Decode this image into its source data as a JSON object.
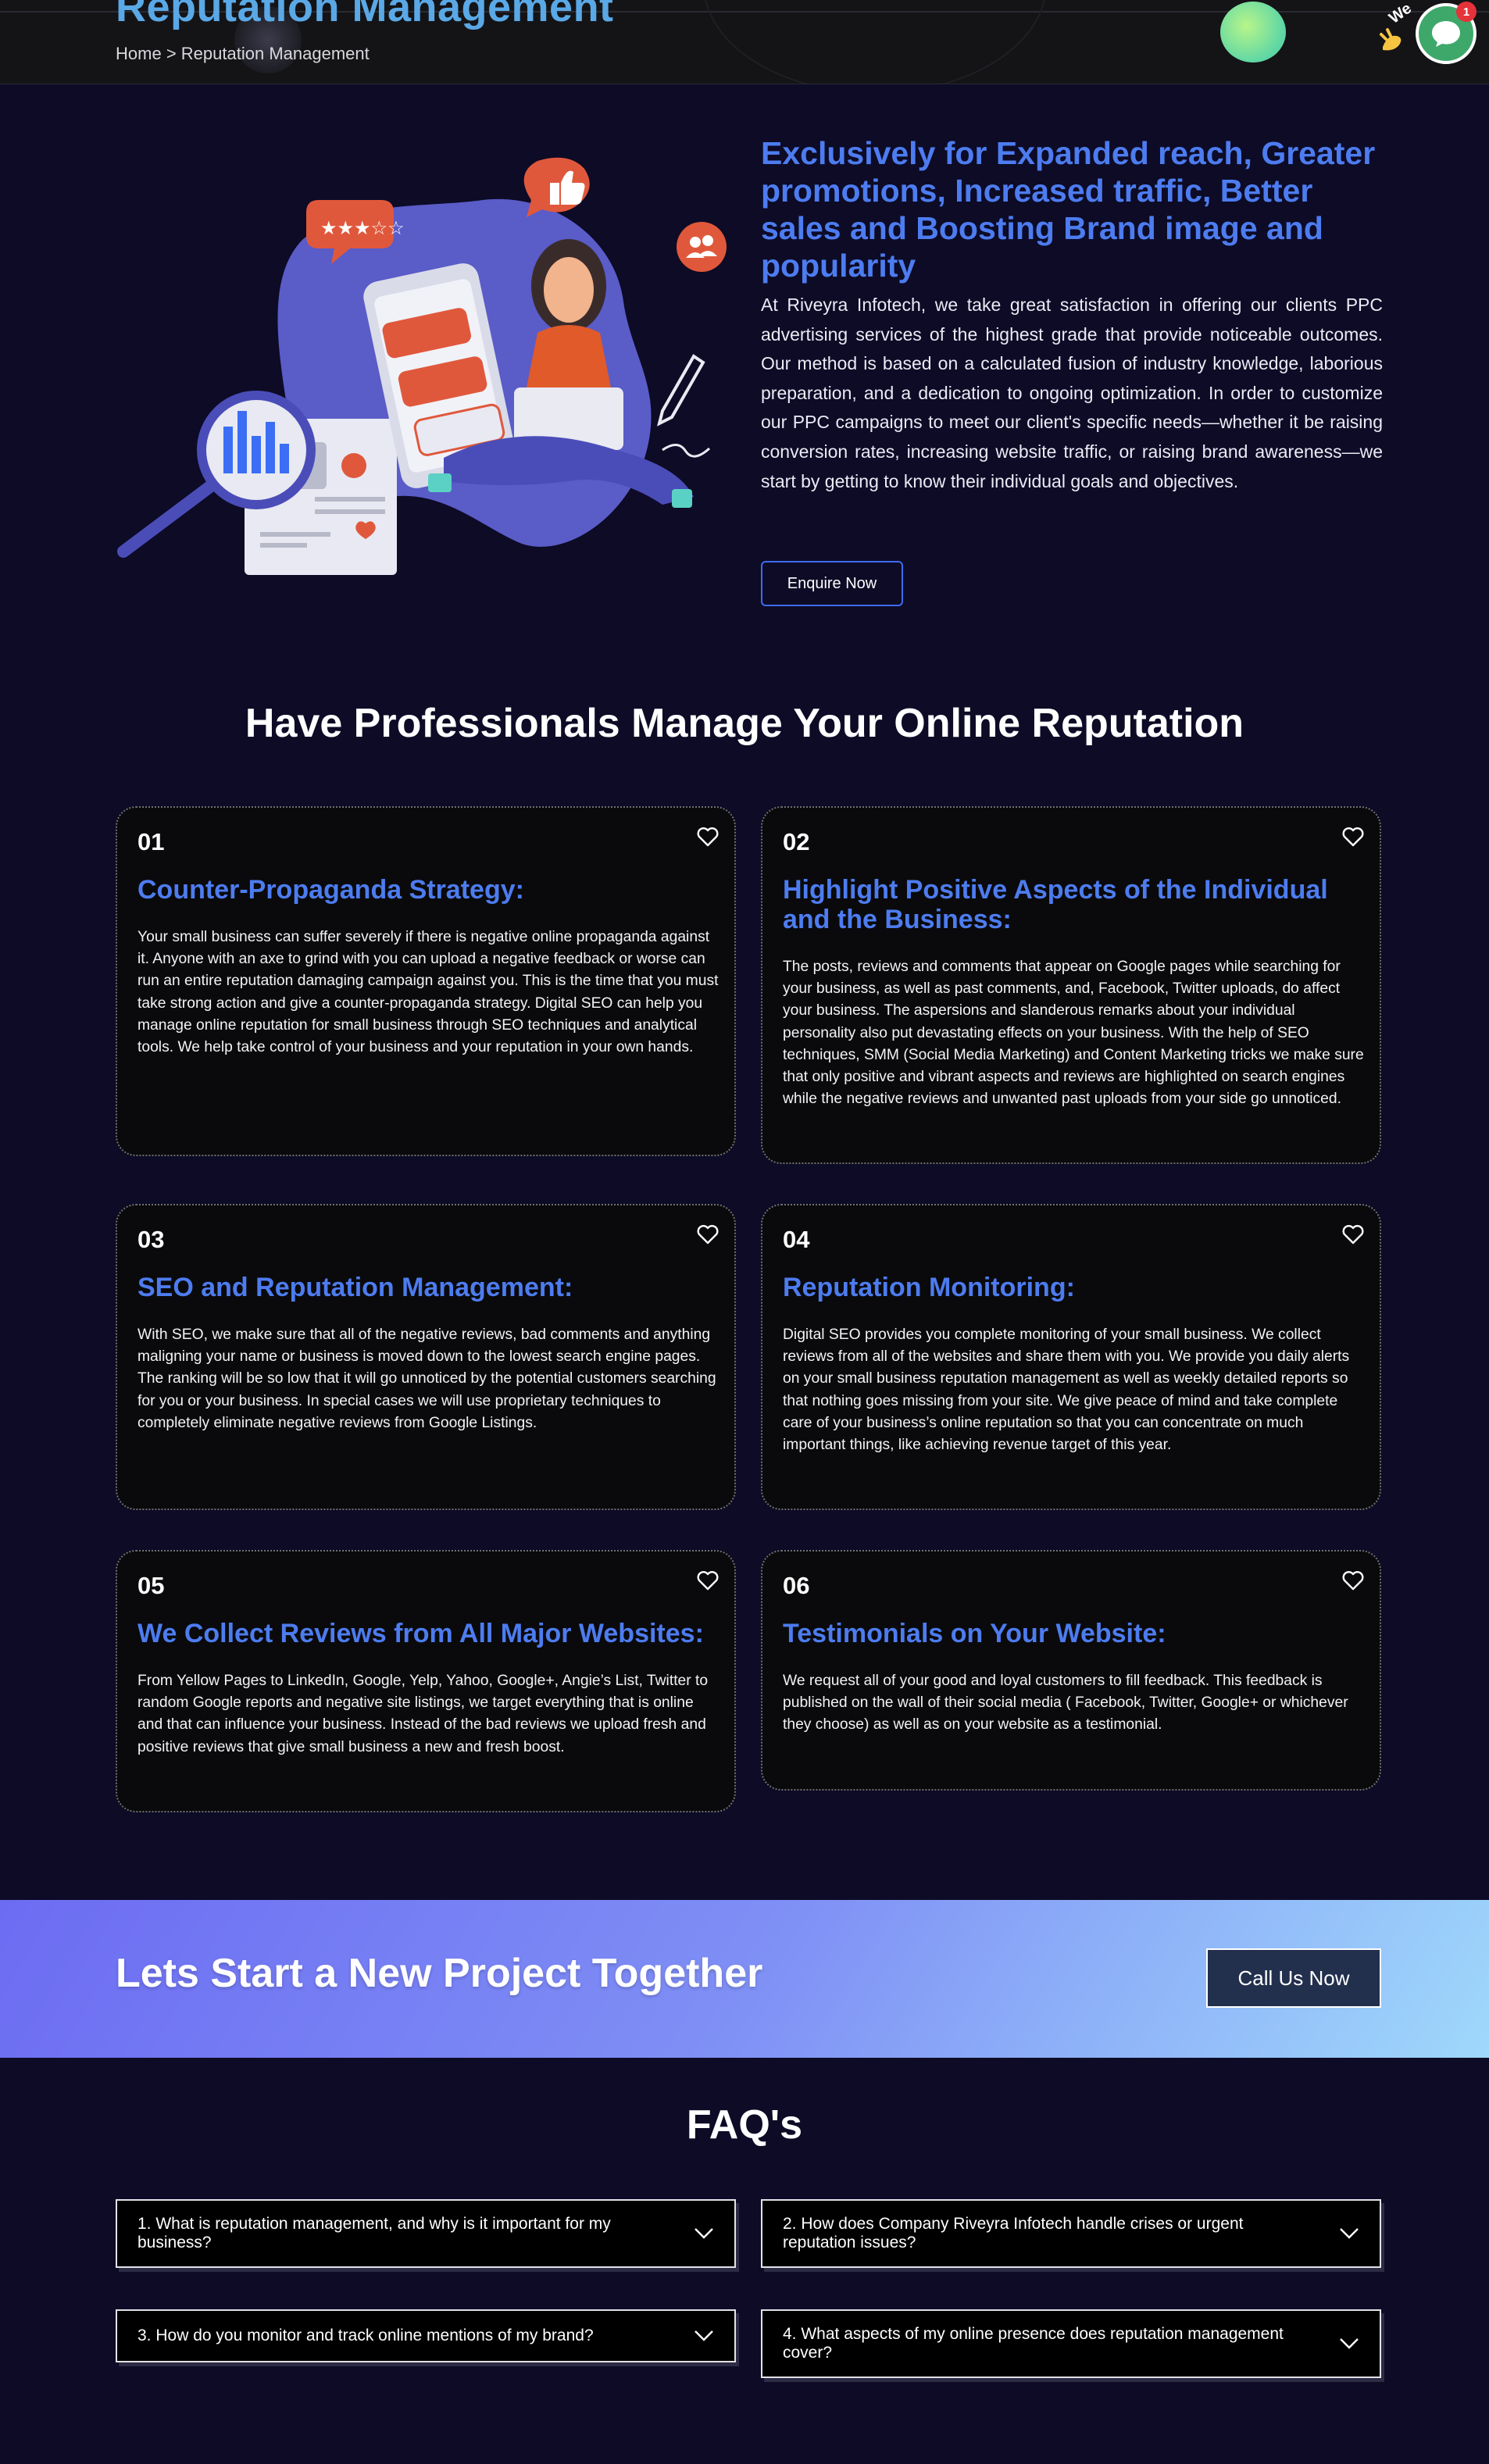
{
  "header": {
    "page_title": "Reputation Management",
    "breadcrumb": {
      "home": "Home",
      "separator": ">",
      "current": "Reputation Management"
    },
    "chat": {
      "badge_count": "1",
      "wave_text": "We"
    }
  },
  "intro": {
    "heading": "Exclusively for Expanded reach, Greater promotions, Increased traffic, Better sales and Boosting Brand image and popularity",
    "body": "At Riveyra Infotech, we take great satisfaction in offering our clients PPC advertising services of the highest grade that provide noticeable outcomes. Our method is based on a calculated fusion of industry knowledge, laborious preparation, and a dedication to ongoing optimization. In order to customize our PPC campaigns to meet our client's specific needs—whether it be raising conversion rates, increasing website traffic, or raising brand awareness—we start by getting to know their individual goals and objectives.",
    "button": "Enquire Now"
  },
  "services": {
    "title": "Have Professionals Manage Your Online Reputation",
    "cards": [
      {
        "num": "01",
        "title": "Counter-Propaganda Strategy:",
        "body": "Your small business can suffer severely if there is negative online propaganda against it. Anyone with an axe to grind with you can upload a negative feedback or worse can run an entire reputation damaging campaign against you. This is the time that you must take strong action and give a counter-propaganda strategy. Digital SEO can help you manage online reputation for small business through SEO techniques and analytical tools. We help take control of your business and your reputation in your own hands."
      },
      {
        "num": "02",
        "title": "Highlight Positive Aspects of the Individual and the Business:",
        "body": "The posts, reviews and comments that appear on Google pages while searching for your business, as well as past comments, and, Facebook, Twitter uploads, do affect your business. The aspersions and slanderous remarks about your individual personality also put devastating effects on your business. With the help of SEO techniques, SMM (Social Media Marketing) and Content Marketing tricks we make sure that only positive and vibrant aspects and reviews are highlighted on search engines while the negative reviews and unwanted past uploads from your side go unnoticed."
      },
      {
        "num": "03",
        "title": "SEO and Reputation Management:",
        "body": "With SEO, we make sure that all of the negative reviews, bad comments and anything maligning your name or business is moved down to the lowest search engine pages. The ranking will be so low that it will go unnoticed by the potential customers searching for you or your business. In special cases we will use proprietary techniques to completely eliminate negative reviews from Google Listings."
      },
      {
        "num": "04",
        "title": "Reputation Monitoring:",
        "body": "Digital SEO provides you complete monitoring of your small business. We collect reviews from all of the websites and share them with you. We provide you daily alerts on your small business reputation management as well as weekly detailed reports so that nothing goes missing from your site. We give peace of mind and take complete care of your business’s online reputation so that you can concentrate on much important things, like achieving revenue target of this year."
      },
      {
        "num": "05",
        "title": "We Collect Reviews from All Major Websites:",
        "body": "From Yellow Pages to LinkedIn, Google, Yelp, Yahoo, Google+, Angie’s List, Twitter to random Google reports and negative site listings, we target everything that is online and that can influence your business. Instead of the bad reviews we upload fresh and positive reviews that give small business a new and fresh boost."
      },
      {
        "num": "06",
        "title": "Testimonials on Your Website:",
        "body": "We request all of your good and loyal customers to fill feedback. This feedback is published on the wall of their social media ( Facebook, Twitter, Google+ or whichever they choose) as well as on your website as a testimonial."
      }
    ]
  },
  "cta": {
    "title": "Lets Start a New Project Together",
    "button": "Call Us Now"
  },
  "faq": {
    "title": "FAQ's",
    "items": [
      "1. What is reputation management, and why is it important for my business?",
      "2. How does Company Riveyra Infotech handle crises or urgent reputation issues?",
      "3. How do you monitor and track online mentions of my brand?",
      "4. What aspects of my online presence does reputation management cover?"
    ]
  },
  "colors": {
    "background": "#0d0b26",
    "accent_blue": "#4d7cf0",
    "card_bg": "#0a0a0c",
    "cta_gradient_start": "#6c6cf2",
    "cta_gradient_end": "#9fd8fb",
    "chat_green": "#3ea86a"
  }
}
